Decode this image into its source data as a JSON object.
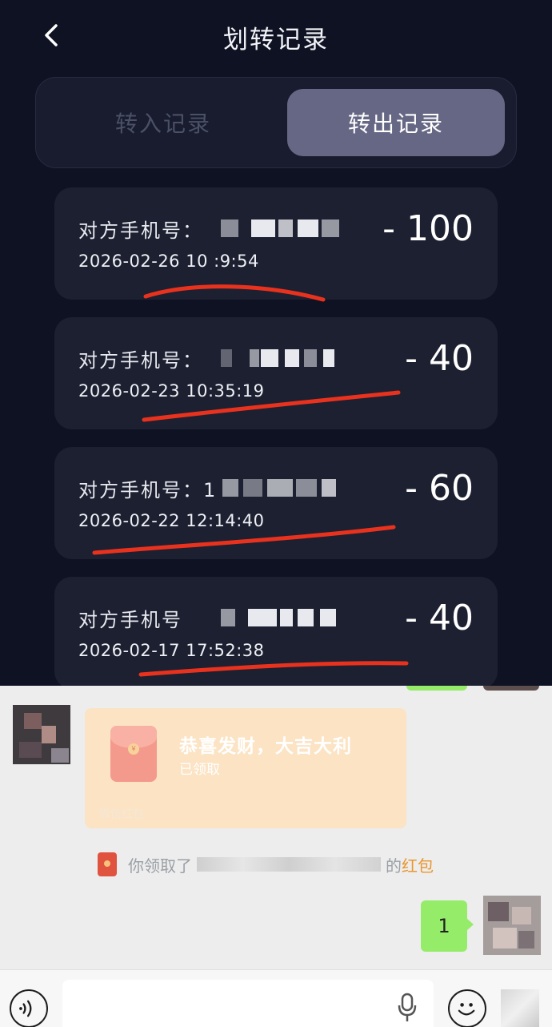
{
  "header": {
    "title": "划转记录",
    "back_icon": "chevron-left-icon"
  },
  "tabs": [
    {
      "label": "转入记录",
      "active": false
    },
    {
      "label": "转出记录",
      "active": true
    }
  ],
  "records": [
    {
      "phone_label": "对方手机号：",
      "date": "2026-02-26 10 :9:54",
      "amount": "- 100"
    },
    {
      "phone_label": "对方手机号：",
      "date": "2026-02-23 10:35:19",
      "amount": "- 40"
    },
    {
      "phone_label": "对方手机号：1",
      "date": "2026-02-22 12:14:40",
      "amount": "- 60"
    },
    {
      "phone_label": "对方手机号",
      "date": "2026-02-17 17:52:38",
      "amount": "- 40"
    }
  ],
  "chat": {
    "red_packet": {
      "greeting": "恭喜发财，大吉大利",
      "status": "已领取",
      "brand": "微信红包",
      "coin_glyph": "￥"
    },
    "system_msg": {
      "prefix": "你领取了",
      "suffix": "的",
      "link": "红包"
    },
    "my_message": "1"
  },
  "colors": {
    "accent_red": "#e8321e",
    "bubble_green": "#95ec69",
    "tab_active": "#666784",
    "red_packet_bg": "#fbe3c4"
  }
}
